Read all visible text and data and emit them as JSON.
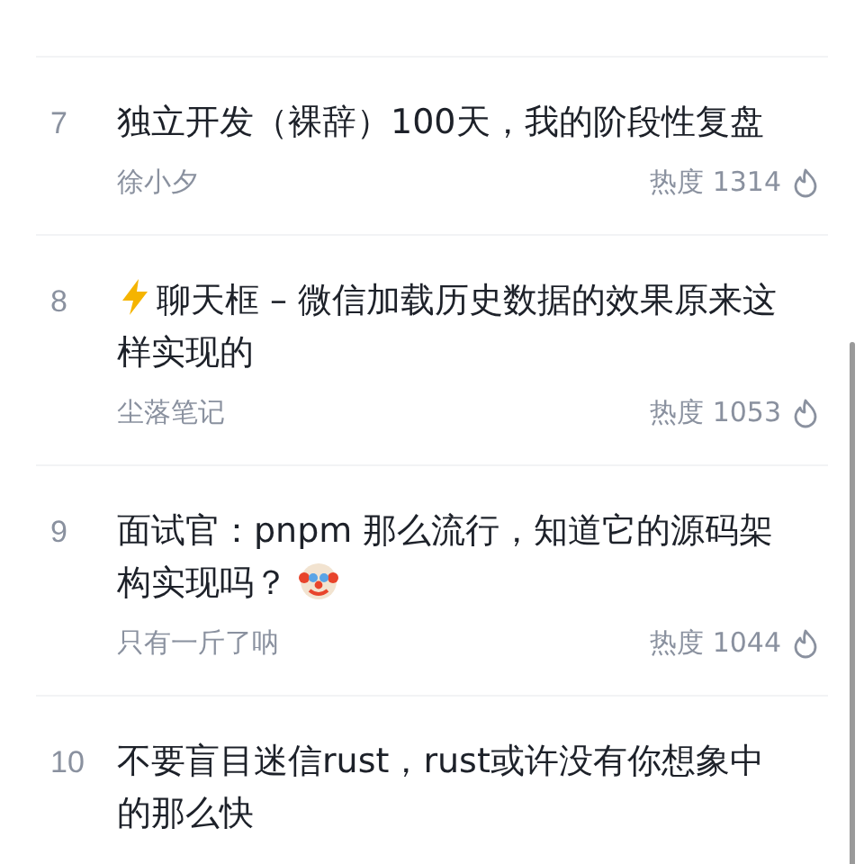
{
  "articles": [
    {
      "rank": "7",
      "title": "独立开发（裸辞）100天，我的阶段性复盘",
      "kind": "plain",
      "author": "徐小夕",
      "heat": "热度 1314"
    },
    {
      "rank": "8",
      "title": "聊天框 – 微信加载历史数据的效果原来这样实现的",
      "kind": "lightning",
      "author": "尘落笔记",
      "heat": "热度 1053"
    },
    {
      "rank": "9",
      "title": "面试官：pnpm 那么流行，知道它的源码架构实现吗？",
      "kind": "clown",
      "author": "只有一斤了呐",
      "heat": "热度 1044"
    },
    {
      "rank": "10",
      "title": "不要盲目迷信rust，rust或许没有你想象中的那么快",
      "kind": "plain"
    }
  ]
}
